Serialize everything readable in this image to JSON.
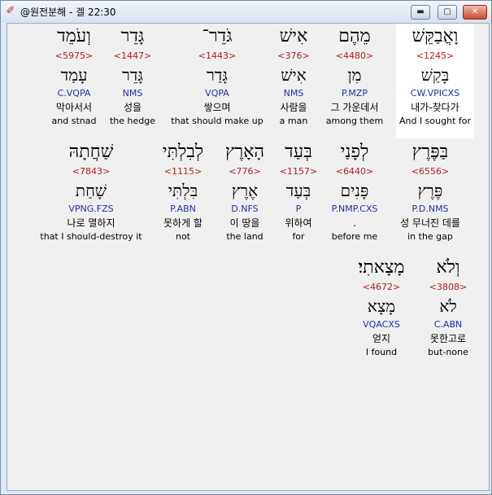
{
  "window": {
    "title": "@원전분해 - 겔 22:30",
    "minimize_label": "▬",
    "maximize_label": "▢",
    "close_label": "✕",
    "icon": "app-icon"
  },
  "rows": [
    {
      "words": [
        {
          "hebrew": "וָאֲבַקֵּשׁ",
          "strong": "<1245>",
          "lemma": "בָּקַשׁ",
          "parse": "CW.VPICXS",
          "korean": "내가-찾다가",
          "english": "And I sought for",
          "selected": true
        },
        {
          "hebrew": "מֵהֶם",
          "strong": "<4480>",
          "lemma": "מִן",
          "parse": "P.MZP",
          "korean": "그 가운데서",
          "english": "among them",
          "selected": false
        },
        {
          "hebrew": "אִישׁ",
          "strong": "<376>",
          "lemma": "אִישׁ",
          "parse": "NMS",
          "korean": "사람을",
          "english": "a man",
          "selected": false
        },
        {
          "hebrew": "גֹּדֵר־",
          "strong": "<1443>",
          "lemma": "גָּדַר",
          "parse": "VQPA",
          "korean": "쌓으며",
          "english": "that should make up",
          "selected": false
        },
        {
          "hebrew": "גָּדֵר",
          "strong": "<1447>",
          "lemma": "גָּדֵר",
          "parse": "NMS",
          "korean": "성을",
          "english": "the hedge",
          "selected": false
        },
        {
          "hebrew": "וְעֹמֵד",
          "strong": "<5975>",
          "lemma": "עָמַד",
          "parse": "C.VQPA",
          "korean": "막아서서",
          "english": "and stnad",
          "selected": false
        }
      ]
    },
    {
      "words": [
        {
          "hebrew": "בַּפֶּרֶץ",
          "strong": "<6556>",
          "lemma": "פֶּרֶץ",
          "parse": "P.D.NMS",
          "korean": "성 무너진 데를",
          "english": "in the gap",
          "selected": false
        },
        {
          "hebrew": "לְפָנַי",
          "strong": "<6440>",
          "lemma": "פָּנִים",
          "parse": "P.NMP.CXS",
          "korean": ".",
          "english": "before me",
          "selected": false
        },
        {
          "hebrew": "בְּעַד",
          "strong": "<1157>",
          "lemma": "בְּעַד",
          "parse": "P",
          "korean": "위하여",
          "english": "for",
          "selected": false
        },
        {
          "hebrew": "הָאָרֶץ",
          "strong": "<776>",
          "lemma": "אֶרֶץ",
          "parse": "D.NFS",
          "korean": "이 땅을",
          "english": "the land",
          "selected": false
        },
        {
          "hebrew": "לְבִלְתִּי",
          "strong": "<1115>",
          "lemma": "בִּלְתִּי",
          "parse": "P.ABN",
          "korean": "못하게 할",
          "english": "not",
          "selected": false
        },
        {
          "hebrew": "שַׁחֲתָהּ",
          "strong": "<7843>",
          "lemma": "שָׁחַת",
          "parse": "VPNG.FZS",
          "korean": "나로 멸하지",
          "english": "that I should-destroy it",
          "selected": false
        }
      ]
    },
    {
      "words": [
        {
          "hebrew": "וְלֹא",
          "strong": "<3808>",
          "lemma": "לֹא",
          "parse": "C.ABN",
          "korean": "못한고로",
          "english": "but-none",
          "selected": false
        },
        {
          "hebrew": "מָצָאתִי׃",
          "strong": "<4672>",
          "lemma": "מָצָא",
          "parse": "VQACXS",
          "korean": "얻지",
          "english": "I found",
          "selected": false
        }
      ]
    }
  ]
}
